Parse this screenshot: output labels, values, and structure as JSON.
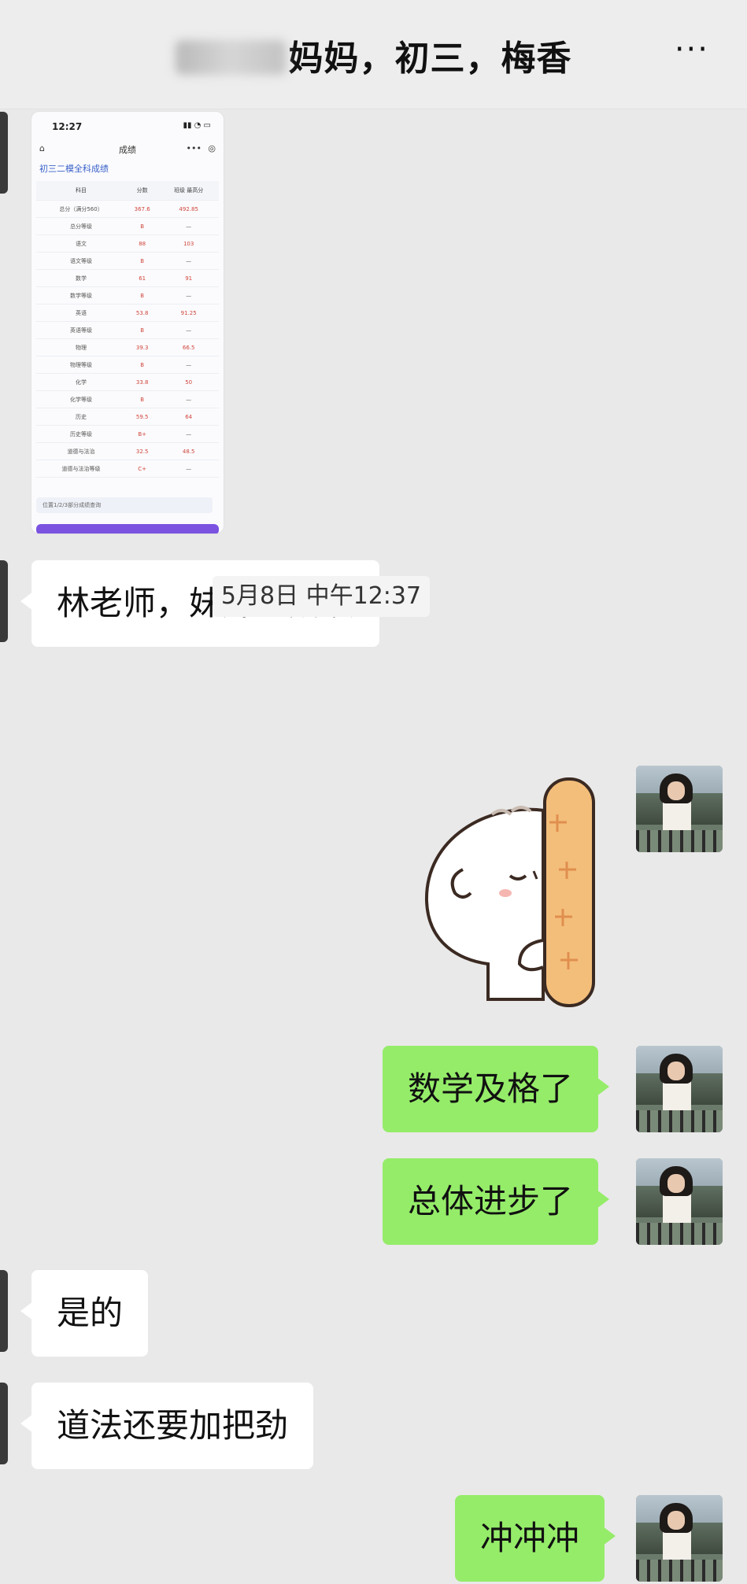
{
  "header": {
    "title_visible": "妈妈，初三，梅香",
    "more_label": "···"
  },
  "screenshot_thumb": {
    "status_time": "12:27",
    "nav_title": "成绩",
    "subtitle": "初三二模全科成绩",
    "columns": [
      "科目",
      "分数",
      "班级\n最高分"
    ],
    "rows": [
      [
        "总分（满分560）",
        "367.6",
        "492.85"
      ],
      [
        "总分等级",
        "B",
        "—"
      ],
      [
        "语文",
        "88",
        "103"
      ],
      [
        "语文等级",
        "B",
        "—"
      ],
      [
        "数学",
        "61",
        "91"
      ],
      [
        "数学等级",
        "B",
        "—"
      ],
      [
        "英语",
        "53.8",
        "91.25"
      ],
      [
        "英语等级",
        "B",
        "—"
      ],
      [
        "物理",
        "39.3",
        "66.5"
      ],
      [
        "物理等级",
        "B",
        "—"
      ],
      [
        "化学",
        "33.8",
        "50"
      ],
      [
        "化学等级",
        "B",
        "—"
      ],
      [
        "历史",
        "59.5",
        "64"
      ],
      [
        "历史等级",
        "B+",
        "—"
      ],
      [
        "道德与法治",
        "32.5",
        "48.5"
      ],
      [
        "道德与法治等级",
        "C+",
        "—"
      ]
    ],
    "footer": "位置1/2/3部分成绩查询"
  },
  "messages": {
    "m1": "林老师，妹妹的成绩",
    "timestamp": "5月8日 中午12:37",
    "m2": "数学及格了",
    "m3": "总体进步了",
    "m4": "是的",
    "m5": "道法还要加把劲",
    "m6": "冲冲冲"
  },
  "colors": {
    "background": "#ededed",
    "bubble_self": "#95ec69",
    "bubble_other": "#ffffff"
  }
}
